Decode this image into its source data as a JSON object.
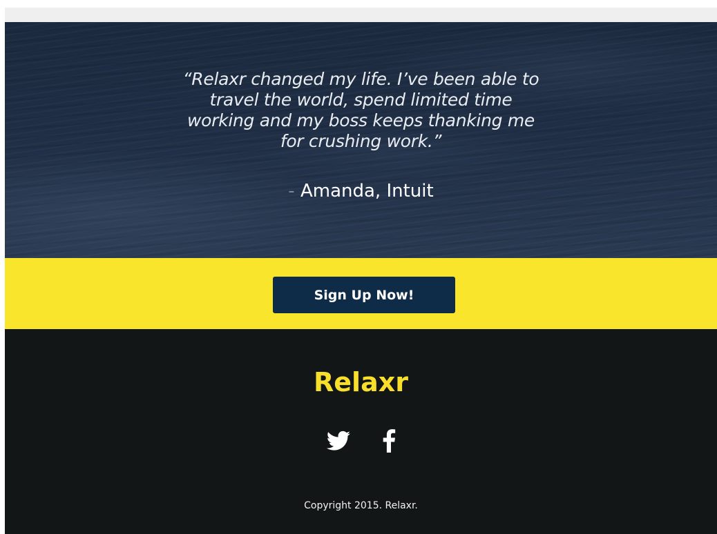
{
  "testimonial": {
    "quote": "“Relaxr changed my life. I’ve been able to travel the world, spend limited time working and my boss keeps thanking me for crushing work.”",
    "dash": "-",
    "author": "Amanda, Intuit"
  },
  "cta": {
    "button_label": "Sign Up Now!"
  },
  "footer": {
    "brand": "Relaxr",
    "social": [
      {
        "name": "twitter",
        "icon": "twitter-bird-icon"
      },
      {
        "name": "facebook",
        "icon": "facebook-f-icon"
      }
    ],
    "copyright": "Copyright 2015. Relaxr."
  },
  "colors": {
    "hero_bg": "#1f2e45",
    "cta_band": "#f8e52c",
    "button_bg": "#0e2c47",
    "footer_bg": "#131617",
    "brand": "#f8df2b"
  }
}
